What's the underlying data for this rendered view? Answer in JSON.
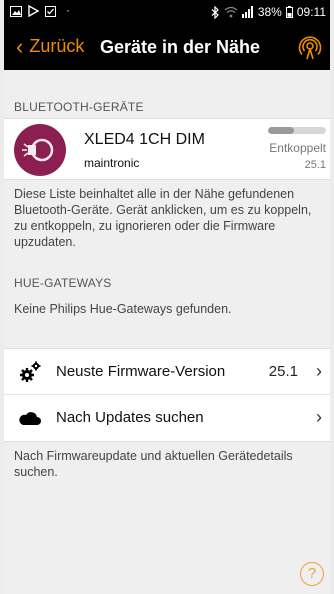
{
  "status_bar": {
    "battery": "38%",
    "time": "09:11",
    "left_icons": [
      "image-icon",
      "play-store-icon",
      "checkbox-icon"
    ],
    "right_icons": [
      "bluetooth-icon",
      "wifi-icon",
      "signal-icon",
      "battery-icon"
    ]
  },
  "app_bar": {
    "back_label": "Zurück",
    "title": "Geräte in der Nähe",
    "action_icon": "radar-icon",
    "accent": "#f08c00"
  },
  "bluetooth": {
    "header": "BLUETOOTH-GERÄTE",
    "device": {
      "name": "XLED4 1CH DIM",
      "vendor": "maintronic",
      "status": "Entkoppelt",
      "version": "25.1",
      "signal_fraction": 0.45
    },
    "description": "Diese Liste beinhaltet alle in der Nähe gefundenen Bluetooth-Geräte. Gerät anklicken, um es zu koppeln, zu entkoppeln, zu ignorieren oder die Firmware upzudaten."
  },
  "hue": {
    "header": "HUE-GATEWAYS",
    "empty_text": "Keine Philips Hue-Gateways gefunden."
  },
  "firmware_list": {
    "items": [
      {
        "icon": "gears-icon",
        "label": "Neuste Firmware-Version",
        "value": "25.1"
      },
      {
        "icon": "cloud-icon",
        "label": "Nach Updates suchen",
        "value": ""
      }
    ],
    "footer": "Nach Firmwareupdate und aktuellen Gerätedetails suchen."
  },
  "help_icon": "help-icon"
}
